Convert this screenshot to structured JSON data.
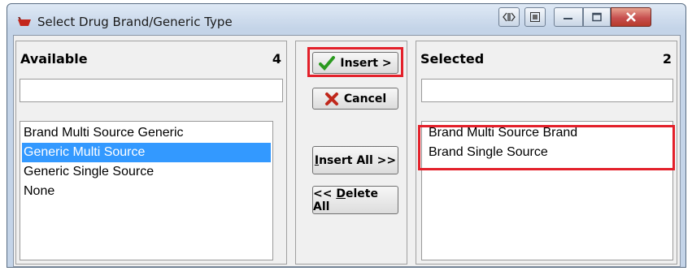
{
  "window": {
    "title": "Select Drug Brand/Generic Type"
  },
  "available": {
    "heading": "Available",
    "count": "4",
    "filter_value": "",
    "items": [
      {
        "label": "Brand Multi Source Generic",
        "selected": false
      },
      {
        "label": "Generic Multi Source",
        "selected": true
      },
      {
        "label": "Generic Single Source",
        "selected": false
      },
      {
        "label": "None",
        "selected": false
      }
    ]
  },
  "selected": {
    "heading": "Selected",
    "count": "2",
    "filter_value": "",
    "items": [
      {
        "label": "Brand Multi Source Brand"
      },
      {
        "label": "Brand Single Source"
      }
    ]
  },
  "buttons": {
    "insert_label": "Insert >",
    "cancel_label": "Cancel",
    "insert_all_label": "Insert All >>",
    "delete_all_prefix": "<< ",
    "delete_all_key": "D",
    "delete_all_rest": "elete All",
    "insert_all_key": "I",
    "insert_all_rest": "nsert All >>"
  },
  "colors": {
    "highlight": "#e3202a",
    "selection": "#3399ff",
    "check": "#2b9a1f",
    "cancel_x": "#c0281c"
  }
}
